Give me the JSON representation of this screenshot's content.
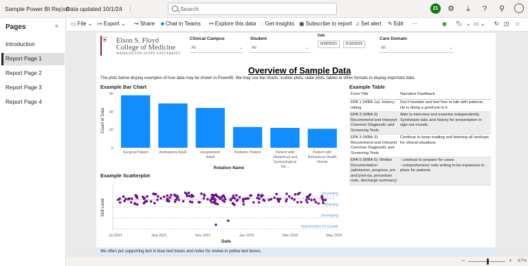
{
  "header": {
    "app_title": "Sample Power BI Report",
    "updated": "Data updated 10/1/24",
    "search_placeholder": "Search",
    "notification_count": "21"
  },
  "sidebar": {
    "title": "Pages",
    "items": [
      {
        "label": "Introduction",
        "active": false
      },
      {
        "label": "Report Page 1",
        "active": true
      },
      {
        "label": "Report Page 2",
        "active": false
      },
      {
        "label": "Report Page 3",
        "active": false
      },
      {
        "label": "Report Page 4",
        "active": false
      }
    ]
  },
  "toolbar": {
    "file": "File",
    "export": "Export",
    "share": "Share",
    "chat": "Chat in Teams",
    "explore": "Explore this data",
    "insights": "Get insights",
    "subscribe": "Subscribe to report",
    "alert": "Set alert",
    "edit": "Edit",
    "more": "···"
  },
  "report": {
    "logo": {
      "line1": "Elson S. Floyd",
      "line2": "College of Medicine",
      "line3": "WASHINGTON STATE UNIVERSITY"
    },
    "slicers": [
      {
        "label": "Clinical Campus",
        "value": "All"
      },
      {
        "label": "Student",
        "value": "All"
      },
      {
        "label": "Care Domain",
        "value": "All"
      }
    ],
    "date": {
      "label": "Date",
      "start": "6/28/2021",
      "end": "5/10/2022"
    },
    "title": "Overview of Sample Data",
    "intro": "The plots below display examples of how data may be shown in PowerBI. We may use bar charts, scatter plots, radar plots, tables or other formats to display important data.",
    "bar_title": "Example Bar Chart",
    "scatter_title": "Example Scatterplot",
    "table_title": "Example Table",
    "footer": "We often put supporting text in blue text boxes and notes for review in yellow text boxes."
  },
  "table": {
    "headers": [
      "Form Title",
      "Narrative Feedback"
    ],
    "rows": [
      [
        "EPA 1 (WBA 1a): History-taking",
        "Don't hesitate and feel free to talk with patients. He is doing a good job in it."
      ],
      [
        "EPA 3 (WBA 3): Recommend and Interpret Common Diagnostic and Screening Tests",
        "Able to interview and examine independently. Synthesize labs and history for presentation in sign-out rounds."
      ],
      [
        "EPA 3 (WBA 3): Recommend and Interpret Common Diagnostic and Screening Tests",
        "Continue to keep reading and learning all workups for clinical situations"
      ],
      [
        "EPA 5 (WBA 5): Written Documentation (admission, progress, pre and post-op, procedure note, discharge summary)",
        "- continue to prepare for cases\n- comprehensive note writing to be expansive in plans for patients"
      ]
    ]
  },
  "zoom": {
    "value": "87%",
    "level": 0.87
  },
  "chart_data": [
    {
      "type": "bar",
      "title": "Example Bar Chart",
      "xlabel": "Rotation Name",
      "ylabel": "Count of Data",
      "categories": [
        "Surgical Patient",
        "Ambulatory Adult",
        "Hospitalized Adult",
        "Pediatric Patient",
        "Patient with Obstetrical and Gynecological Ne...",
        "Patient with Behavioral Health Needs"
      ],
      "values": [
        58,
        49,
        44,
        23,
        22,
        21
      ],
      "ylim": [
        0,
        60
      ],
      "yticks": [
        0,
        20,
        40,
        60
      ],
      "color": "#118dff"
    },
    {
      "type": "scatter",
      "title": "Example Scatterplot",
      "xlabel": "Date",
      "ylabel": "Skill Level",
      "xticks": [
        "Jul 2021",
        "Sep 2021",
        "Nov 2021",
        "Jan 2022",
        "Mar 2022",
        "May 2022"
      ],
      "levels": [
        "Opportunities for Growth",
        "Developing",
        "Achieving",
        "Exceeding"
      ],
      "color": "#6b0f8a",
      "reference_color": "#4e9fdd"
    }
  ]
}
